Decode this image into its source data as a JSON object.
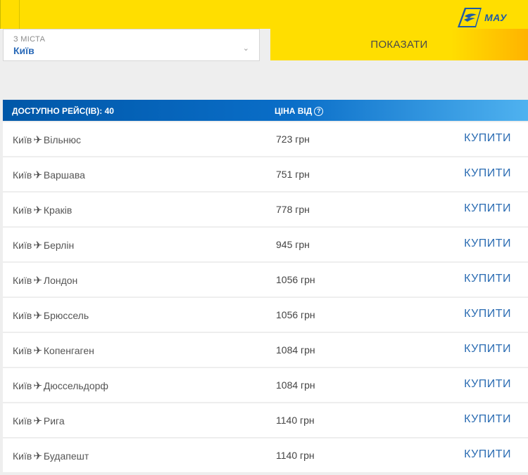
{
  "header": {
    "brand": "МАУ"
  },
  "search": {
    "from_label": "З МІСТА",
    "from_value": "Київ",
    "show_button": "ПОКАЗАТИ"
  },
  "table": {
    "count_label": "ДОСТУПНО РЕЙС(ІВ): 40",
    "price_label": "ЦІНА ВІД",
    "buy_label": "КУПИТИ",
    "rows": [
      {
        "from": "Київ",
        "to": "Вільнюс",
        "price": "723 грн"
      },
      {
        "from": "Київ",
        "to": "Варшава",
        "price": "751 грн"
      },
      {
        "from": "Київ",
        "to": "Краків",
        "price": "778 грн"
      },
      {
        "from": "Київ",
        "to": "Берлін",
        "price": "945 грн"
      },
      {
        "from": "Київ",
        "to": "Лондон",
        "price": "1056 грн"
      },
      {
        "from": "Київ",
        "to": "Брюссель",
        "price": "1056 грн"
      },
      {
        "from": "Київ",
        "to": "Копенгаген",
        "price": "1084 грн"
      },
      {
        "from": "Київ",
        "to": "Дюссельдорф",
        "price": "1084 грн"
      },
      {
        "from": "Київ",
        "to": "Рига",
        "price": "1140 грн"
      },
      {
        "from": "Київ",
        "to": "Будапешт",
        "price": "1140 грн"
      }
    ]
  },
  "colors": {
    "yellow": "#ffde00",
    "blue": "#0057a8",
    "link": "#2c6db3"
  }
}
